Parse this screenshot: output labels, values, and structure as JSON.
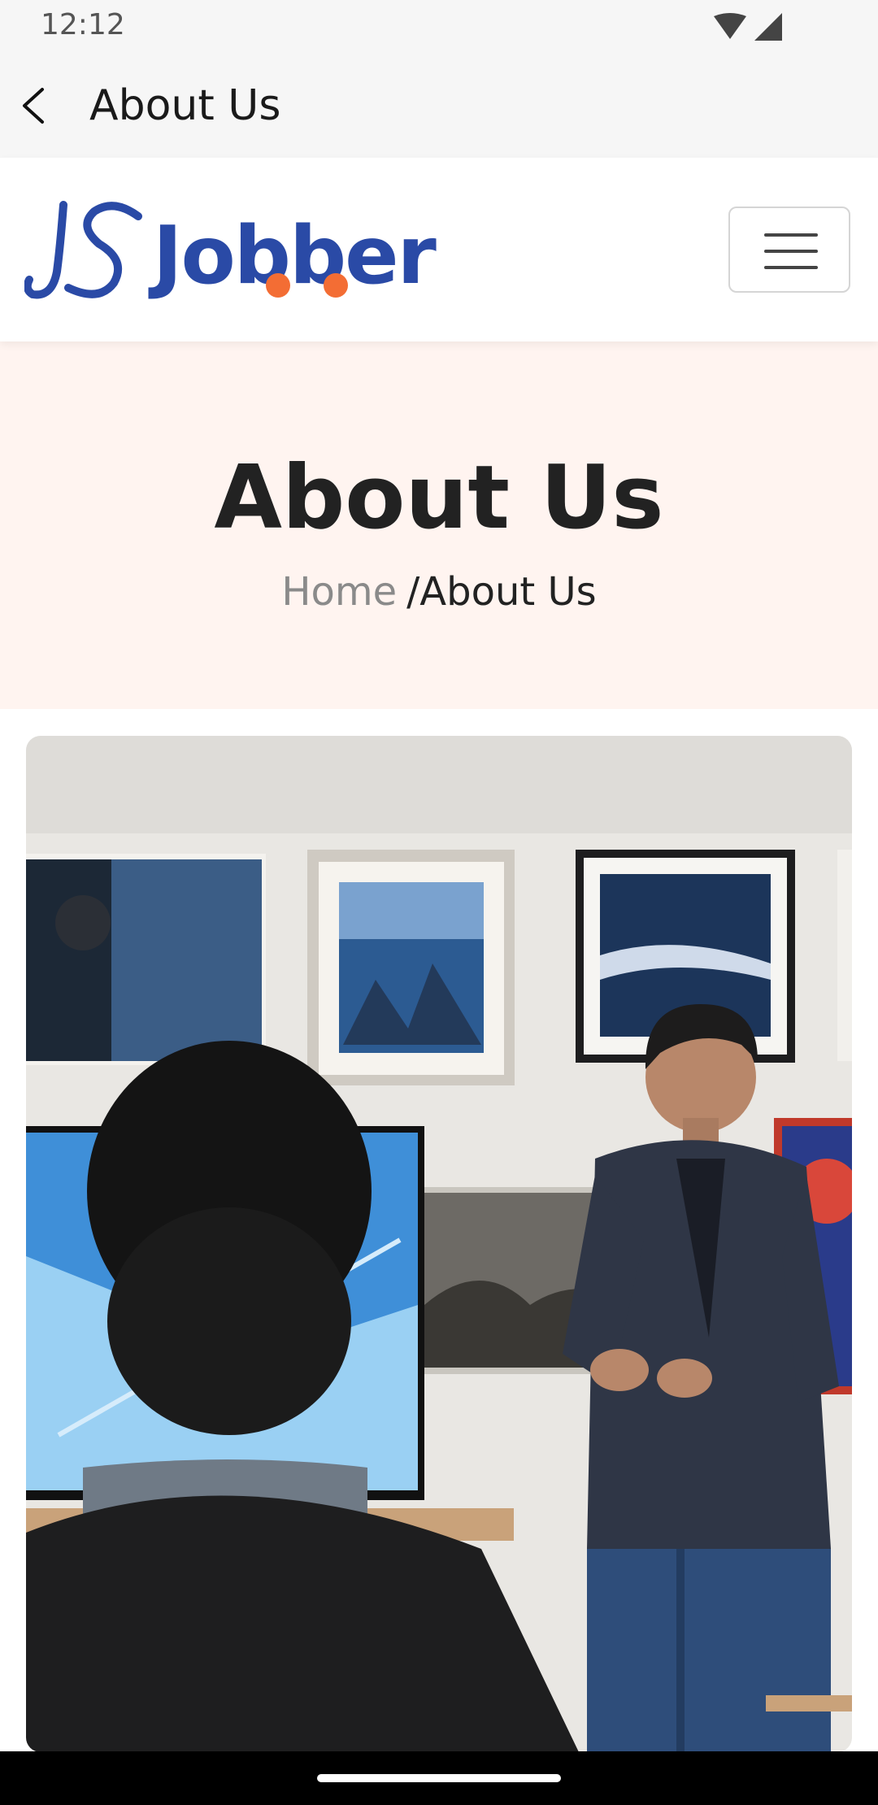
{
  "status_bar": {
    "time": "12:12",
    "icons": [
      "wifi-icon",
      "cellular-signal-icon"
    ]
  },
  "app_bar": {
    "title": "About Us",
    "back_icon": "back-arrow-icon"
  },
  "site_header": {
    "brand": "Jobber",
    "logo_icon": "jobber-logo-icon",
    "menu_icon": "hamburger-menu-icon",
    "colors": {
      "brand_blue": "#2a4aa6",
      "accent_orange": "#f36d34"
    }
  },
  "hero": {
    "title": "About Us",
    "breadcrumb": {
      "home": "Home",
      "separator": "/",
      "current": "About Us"
    },
    "background": "#fff4f0"
  },
  "content": {
    "image": "presentation-gallery-photo"
  }
}
